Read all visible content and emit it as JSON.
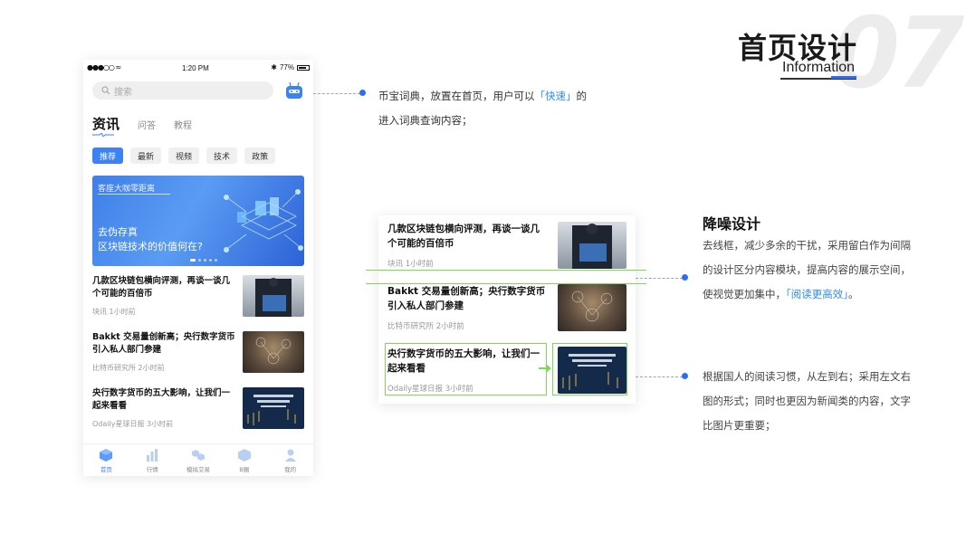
{
  "header": {
    "number": "07",
    "title": "首页设计",
    "subtitle": "Information"
  },
  "phone": {
    "status": {
      "time": "1:20 PM",
      "battery": "77%"
    },
    "search_placeholder": "搜索",
    "tabs": [
      {
        "label": "资讯",
        "active": true
      },
      {
        "label": "问答",
        "active": false
      },
      {
        "label": "教程",
        "active": false
      }
    ],
    "chips": [
      {
        "label": "推荐",
        "active": true
      },
      {
        "label": "最新",
        "active": false
      },
      {
        "label": "视频",
        "active": false
      },
      {
        "label": "技术",
        "active": false
      },
      {
        "label": "政策",
        "active": false
      }
    ],
    "banner": {
      "top_text": "客座大咖零距离",
      "line1": "去伪存真",
      "line2": "区块链技术的价值何在?"
    },
    "news": [
      {
        "title": "几款区块链包横向评测，再谈一谈几个可能的百倍币",
        "source": "块讯",
        "time": "1小时前"
      },
      {
        "title": "Bakkt 交易量创新高；央行数字货币引入私人部门参建",
        "source": "比特币研究所",
        "time": "2小时前"
      },
      {
        "title": "央行数字货币的五大影响，让我们一起来看看",
        "source": "Odaily星球日报",
        "time": "3小时前"
      }
    ],
    "bottom_nav": [
      {
        "label": "首页",
        "icon": "cube-icon",
        "active": true
      },
      {
        "label": "行情",
        "icon": "chart-icon",
        "active": false
      },
      {
        "label": "模拟交易",
        "icon": "cubes-icon",
        "active": false
      },
      {
        "label": "B圈",
        "icon": "hexagon-icon",
        "active": false
      },
      {
        "label": "我的",
        "icon": "user-icon",
        "active": false
      }
    ]
  },
  "annotation1": {
    "line1_prefix": "币宝词典，放置在首页，用户可以",
    "highlight": "「快速」",
    "line1_suffix": "的",
    "line2": "进入词典查询内容；"
  },
  "card": {
    "news": [
      {
        "title": "几款区块链包横向评测，再谈一谈几个可能的百倍币",
        "source": "块讯",
        "time": "1小时前"
      },
      {
        "title": "Bakkt 交易量创新高；央行数字货币引入私人部门参建",
        "source": "比特币研究所",
        "time": "2小时前"
      },
      {
        "title": "央行数字货币的五大影响，让我们一起来看看",
        "source": "Odaily星球日报",
        "time": "3小时前"
      }
    ]
  },
  "annotation2": {
    "title": "降噪设计",
    "text_prefix": "去线框，减少多余的干扰，采用留白作为间隔的设计区分内容模块，提高内容的展示空间，使视觉更加集中，",
    "highlight": "「阅读更高效」",
    "text_suffix": "。"
  },
  "annotation3": {
    "text": "根据国人的阅读习惯，从左到右；采用左文右图的形式；同时也更因为新闻类的内容，文字比图片更重要；"
  },
  "colors": {
    "accent": "#2d6df5",
    "highlight": "#2d8cf0",
    "green": "#7ed957"
  }
}
